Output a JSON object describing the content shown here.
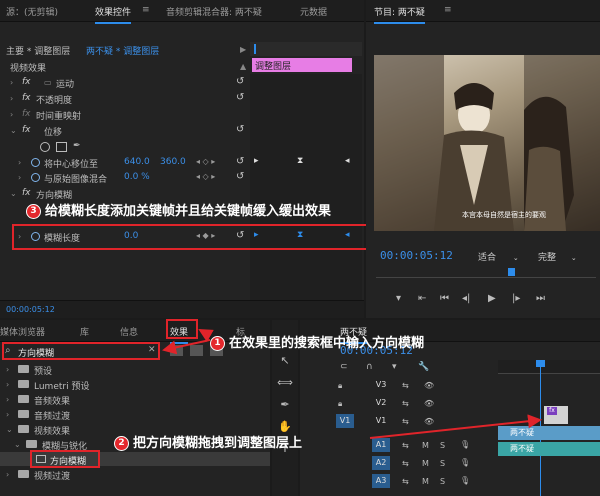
{
  "source_tabs": {
    "source": "源：(无剪辑)",
    "effect_controls": "效果控件",
    "menu_glyph": "≡",
    "audio_mixer": "音频剪辑混合器: 两不疑",
    "metadata": "元数据"
  },
  "effect_controls": {
    "master_label": "主要 * 调整图层",
    "sequence_label": "两不疑 * 调整图层",
    "clip_label": "调整图层",
    "section_video": "视频效果",
    "motion": "运动",
    "opacity": "不透明度",
    "time_remap": "时间重映射",
    "transform": "位移",
    "anchor": "将中心移位至",
    "anchor_x": "640.0",
    "anchor_y": "360.0",
    "blend_label": "与原始图像混合",
    "blend_value": "0.0 %",
    "dir_blur": "方向模糊",
    "blur_length": "模糊长度",
    "blur_value": "0.0",
    "fx_glyph": "fx",
    "reset_glyph": "↺",
    "timecode": "00:00:05:12"
  },
  "program": {
    "title": "节目: 两不疑",
    "menu_glyph": "≡",
    "timecode": "00:00:05:12",
    "fit": "适合",
    "quality": "完整",
    "subtitle": "本宫本母自然是宿主的要观"
  },
  "effects_panel": {
    "tabs": [
      "媒体浏览器",
      "库",
      "信息",
      "效果",
      "标"
    ],
    "search_value": "方向模糊",
    "tree": [
      "预设",
      "Lumetri 预设",
      "音频效果",
      "音频过渡",
      "视频效果",
      "模糊与锐化",
      "方向模糊",
      "视频过渡"
    ]
  },
  "timeline": {
    "title": "两不疑",
    "timecode": "00:00:05:12",
    "tracks_video": [
      "V3",
      "V2",
      "V1"
    ],
    "tracks_audio": [
      "A1",
      "A2",
      "A3"
    ],
    "clip_v1_label": "两不疑",
    "clip_a1_label": "两不疑",
    "mute": "M",
    "solo": "S"
  },
  "annotations": {
    "a1_num": "1",
    "a1_text": "在效果里的搜索框中输入方向模糊",
    "a2_num": "2",
    "a2_text": "把方向模糊拖拽到调整图层上",
    "a3_num": "3",
    "a3_text": "给模糊长度添加关键帧并且给关键帧缓入缓出效果"
  },
  "colors": {
    "accent": "#2d8ceb",
    "annotation_red": "#e0242a",
    "clip_pink": "#e77de5",
    "track_blue": "#2a5d8f",
    "clip_teal": "#3aa5a5"
  }
}
